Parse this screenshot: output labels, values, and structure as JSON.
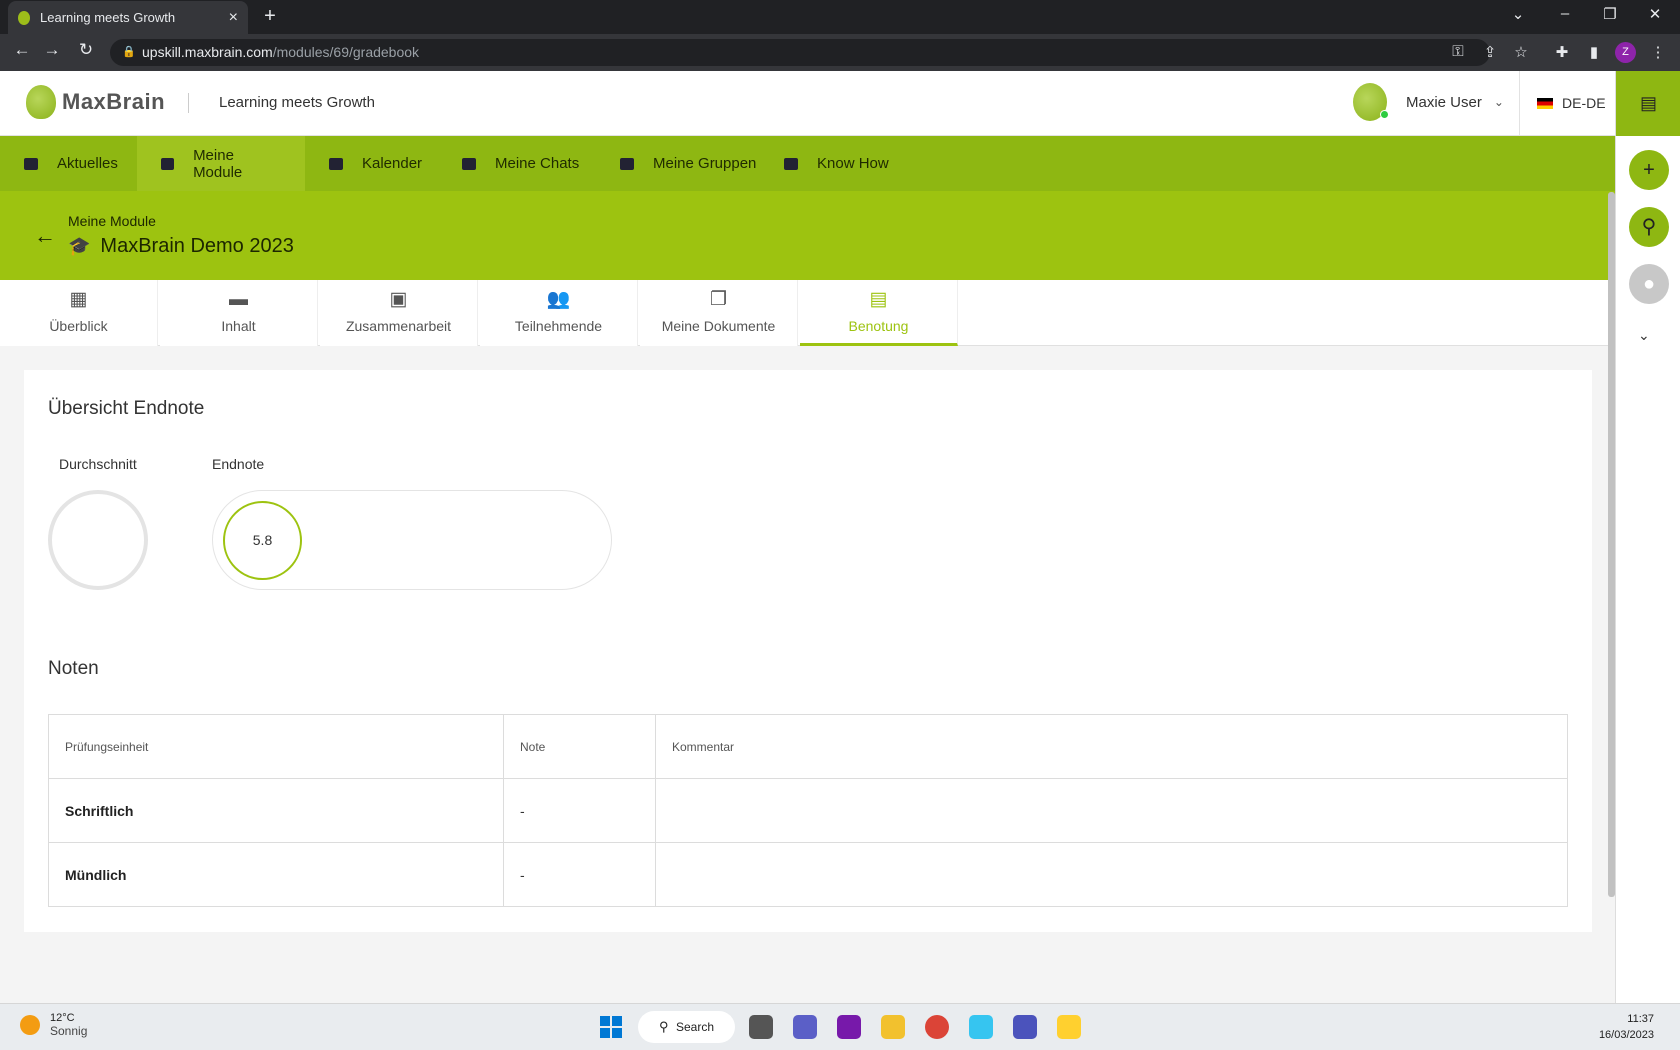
{
  "browser": {
    "tab_title": "Learning meets Growth",
    "url_host": "upskill.maxbrain.com",
    "url_path": "/modules/69/gradebook",
    "profile_initial": "Z"
  },
  "header": {
    "logo_text": "MaxBrain",
    "tagline": "Learning meets Growth",
    "user_name": "Maxie User",
    "language": "DE-DE"
  },
  "nav": {
    "items": [
      {
        "label": "Aktuelles"
      },
      {
        "label": "Meine Module"
      },
      {
        "label": "Kalender"
      },
      {
        "label": "Meine Chats"
      },
      {
        "label": "Meine Gruppen"
      },
      {
        "label": "Know How"
      }
    ],
    "active": "Meine Module"
  },
  "module": {
    "breadcrumb": "Meine Module",
    "title": "MaxBrain Demo 2023"
  },
  "tabs": {
    "items": [
      {
        "label": "Überblick",
        "icon": "dashboard-icon"
      },
      {
        "label": "Inhalt",
        "icon": "folder-icon"
      },
      {
        "label": "Zusammenarbeit",
        "icon": "shared-folder-icon"
      },
      {
        "label": "Teilnehmende",
        "icon": "people-icon"
      },
      {
        "label": "Meine Dokumente",
        "icon": "documents-icon"
      },
      {
        "label": "Benotung",
        "icon": "grade-icon"
      }
    ],
    "active": "Benotung"
  },
  "overview": {
    "title": "Übersicht Endnote",
    "average_label": "Durchschnitt",
    "final_label": "Endnote",
    "final_value": "5.8"
  },
  "grades": {
    "title": "Noten",
    "columns": [
      "Prüfungseinheit",
      "Note",
      "Kommentar"
    ],
    "rows": [
      [
        "Schriftlich",
        "-",
        ""
      ],
      [
        "Mündlich",
        "-",
        ""
      ]
    ]
  },
  "taskbar": {
    "temperature": "12°C",
    "weather": "Sonnig",
    "search": "Search",
    "time": "11:37",
    "date": "16/03/2023"
  },
  "colors": {
    "brand_green": "#8eb712",
    "banner_green": "#9dc310",
    "active_tab": "#9dc310"
  }
}
